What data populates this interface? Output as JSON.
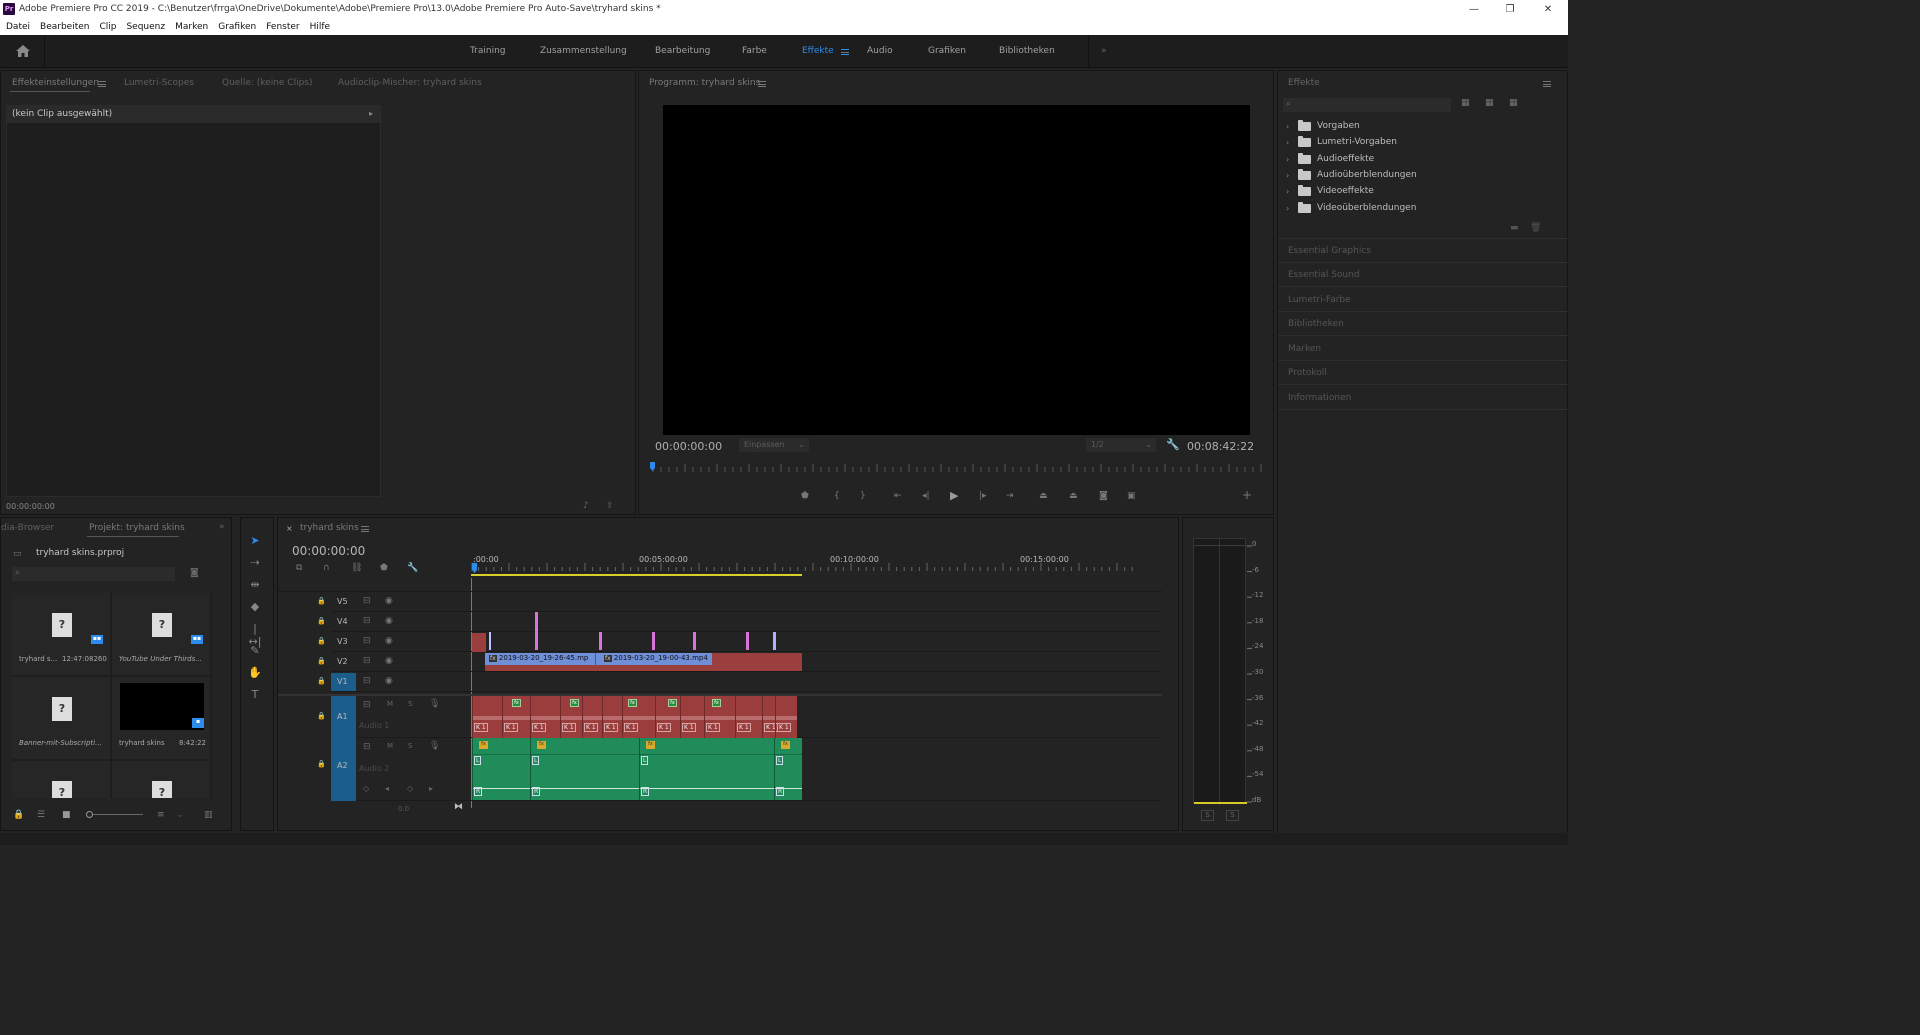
{
  "window": {
    "title": "Adobe Premiere Pro CC 2019 - C:\\Benutzer\\frrga\\OneDrive\\Dokumente\\Adobe\\Premiere Pro\\13.0\\Adobe Premiere Pro Auto-Save\\tryhard skins *",
    "app_icon": "Pr",
    "min": "—",
    "max": "❐",
    "close": "✕"
  },
  "menu": [
    "Datei",
    "Bearbeiten",
    "Clip",
    "Sequenz",
    "Marken",
    "Grafiken",
    "Fenster",
    "Hilfe"
  ],
  "workspaces": {
    "items": [
      "Training",
      "Zusammenstellung",
      "Bearbeitung",
      "Farbe",
      "Effekte",
      "Audio",
      "Grafiken",
      "Bibliotheken"
    ],
    "active": "Effekte",
    "more": "»"
  },
  "source_panel": {
    "tabs": [
      "Effekteinstellungen",
      "Lumetri-Scopes",
      "Quelle: (keine Clips)",
      "Audioclip-Mischer: tryhard skins"
    ],
    "no_clip": "(kein Clip ausgewählt)",
    "timecode": "00:00:00:00"
  },
  "program": {
    "title": "Programm: tryhard skins",
    "tc_left": "00:00:00:00",
    "fit": "Einpassen",
    "res": "1/2",
    "tc_right": "00:08:42:22"
  },
  "effects": {
    "title": "Effekte",
    "items": [
      "Vorgaben",
      "Lumetri-Vorgaben",
      "Audioeffekte",
      "Audioüberblendungen",
      "Videoeffekte",
      "Videoüberblendungen"
    ],
    "collapsed": [
      "Essential Graphics",
      "Essential Sound",
      "Lumetri-Farbe",
      "Bibliotheken",
      "Marken",
      "Protokoll",
      "Informationen"
    ]
  },
  "project": {
    "tabs": [
      "dia-Browser",
      "Projekt: tryhard skins"
    ],
    "file": "tryhard skins.prproj",
    "items": [
      {
        "name": "tryhard s...",
        "meta": "12:47:08260"
      },
      {
        "name": "YouTube Under Thirds...",
        "meta": ""
      },
      {
        "name": "Banner-mit-Subscripti...",
        "meta": ""
      },
      {
        "name": "tryhard skins",
        "meta": "8:42:22"
      }
    ]
  },
  "timeline": {
    "title": "tryhard skins",
    "timecode": "00:00:00:00",
    "ruler": [
      ":00:00",
      "00:05:00:00",
      "00:10:00:00",
      "00:15:00:00"
    ],
    "video_tracks": [
      "V5",
      "V4",
      "V3",
      "V2",
      "V1"
    ],
    "audio_tracks": [
      {
        "id": "A1",
        "name": "Audio 1"
      },
      {
        "id": "A2",
        "name": "Audio 2"
      }
    ],
    "track_flags": {
      "mute": "M",
      "solo": "S"
    },
    "clips": [
      "2019-03-20_19-26-45.mp",
      "2019-03-20_19-00-43.mp4"
    ],
    "fx": "fx",
    "k1": "K 1",
    "L": "L",
    "R": "R",
    "zero": "0.0"
  },
  "meter": {
    "labels": [
      "0",
      "-6",
      "-12",
      "-18",
      "-24",
      "-30",
      "-36",
      "-42",
      "-48",
      "-54",
      "dB"
    ],
    "s": "S"
  },
  "colors": {
    "active": "#2d8ceb",
    "audio1": "#9c3d3d",
    "audio2": "#1f8c5a",
    "clip": "#6f8fd8",
    "v2bar": "#9a3e3e",
    "marker": "#d873d8"
  }
}
